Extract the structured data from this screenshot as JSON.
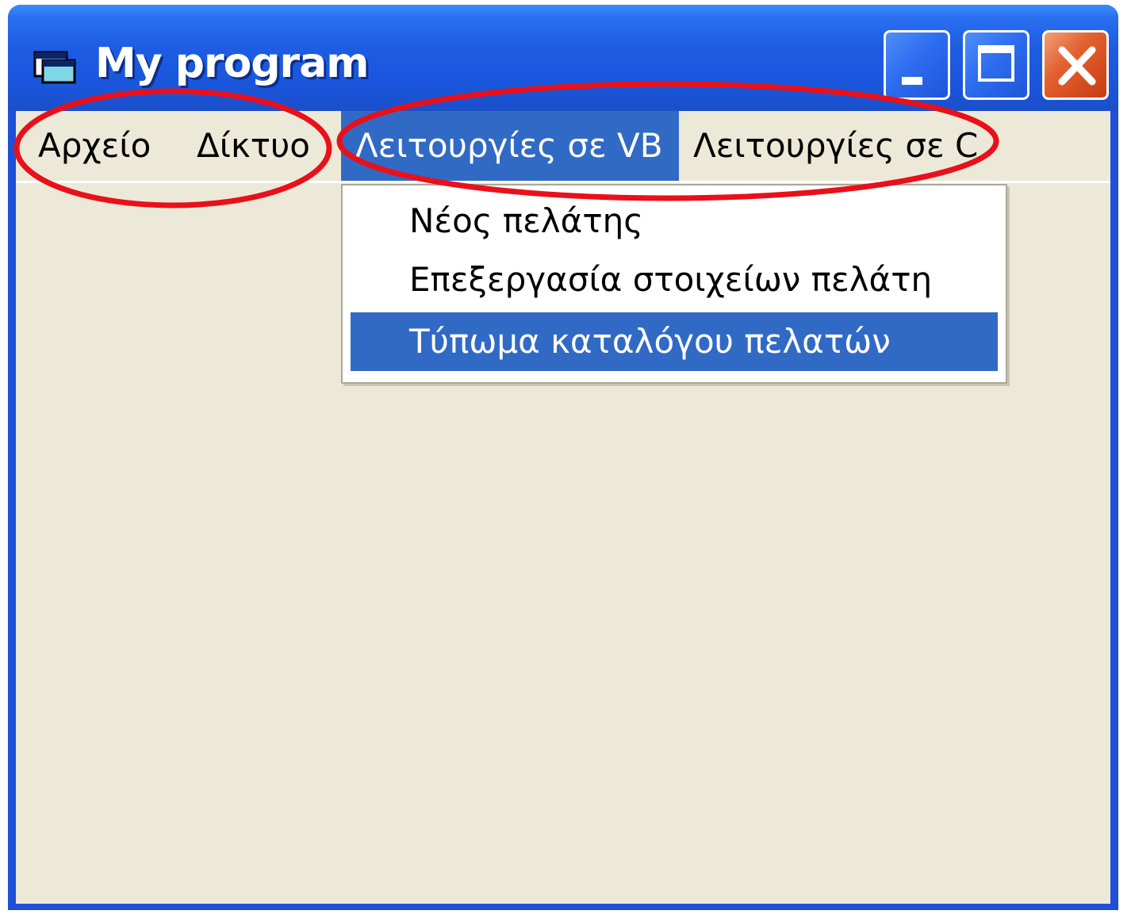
{
  "window": {
    "title": "My program"
  },
  "title_controls": {
    "minimize": "minimize",
    "maximize": "maximize",
    "close": "close"
  },
  "menubar": {
    "items": [
      {
        "label": "Αρχείο"
      },
      {
        "label": "Δίκτυο"
      },
      {
        "label": "Λειτουργίες σε VB",
        "active": true
      },
      {
        "label": "Λειτουργίες σε C"
      }
    ]
  },
  "dropdown": {
    "items": [
      {
        "label": "Νέος πελάτης"
      },
      {
        "label": "Επεξεργασία στοιχείων πελάτη"
      },
      {
        "label": "Τύπωμα καταλόγου πελατών",
        "selected": true
      }
    ]
  },
  "colors": {
    "titlebar": "#1d5ce3",
    "client": "#ece9d8",
    "highlight": "#316ac5",
    "annotation": "#e8101a",
    "close_button": "#e4602f"
  },
  "icons": {
    "app": "app-window-icon",
    "minimize": "minimize-icon",
    "maximize": "maximize-icon",
    "close": "close-icon"
  }
}
